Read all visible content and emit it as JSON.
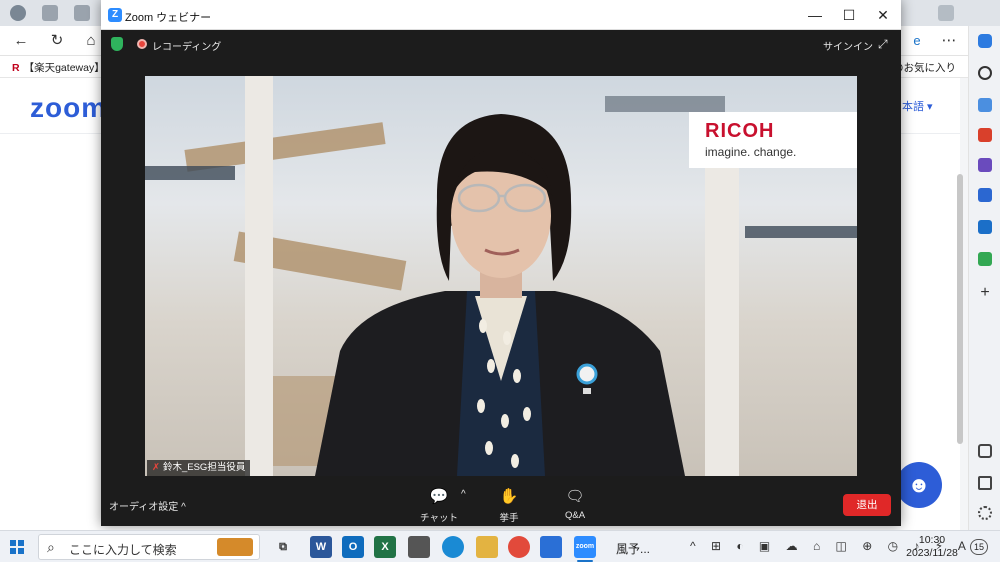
{
  "browser": {
    "bookmark_left": "【楽天gateway】楽",
    "bookmark_left_brand": "R",
    "bookmark_right": "他のお気に入り"
  },
  "site": {
    "logo": "zoom",
    "language": "本語 ▾"
  },
  "zoom": {
    "window_title": "Zoom ウェビナー",
    "app_icon": "Z",
    "recording_label": "レコーディング",
    "signin_label": "サインイン",
    "brand_name": "RICOH",
    "brand_tagline": "imagine. change.",
    "participant_name": "鈴木_ESG担当役員",
    "audio_settings_label": "オーディオ設定 ^",
    "chat_label": "チャット",
    "raise_hand_label": "挙手",
    "qa_label": "Q&A",
    "leave_label": "退出"
  },
  "taskbar": {
    "search_placeholder": "ここに入力して検索",
    "weather_label": "風予...",
    "time": "10:30",
    "date": "2023/11/28",
    "notification_count": "15"
  },
  "colors": {
    "zoom_blue": "#2d5dd7",
    "leave_red": "#e02828",
    "ricoh_red": "#c8102e",
    "record_red": "#e8453c"
  }
}
